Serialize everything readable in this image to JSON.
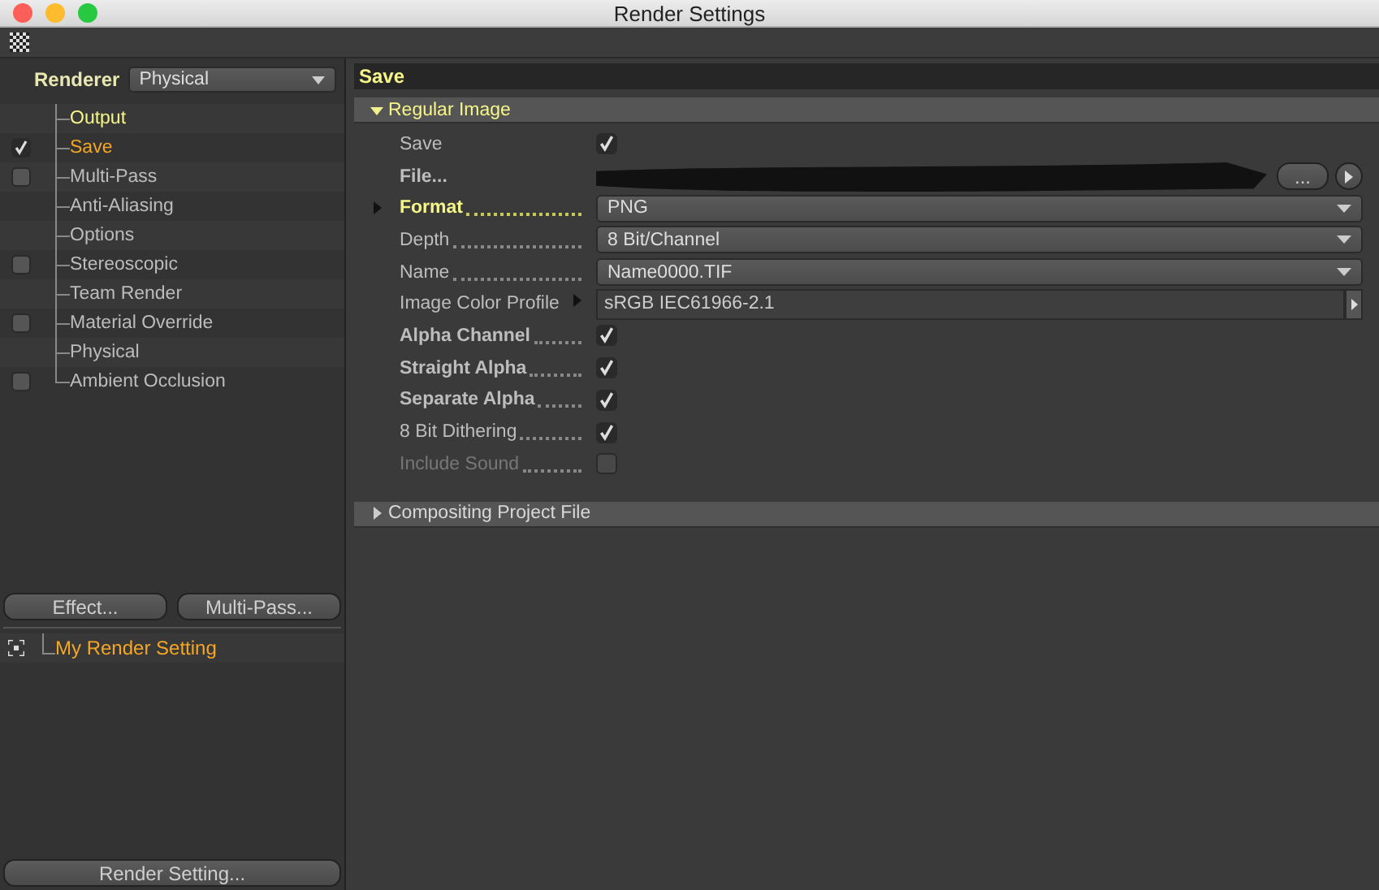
{
  "window": {
    "title": "Render Settings"
  },
  "renderer": {
    "label": "Renderer",
    "value": "Physical"
  },
  "sidebar": {
    "items": [
      {
        "label": "Output",
        "kind": "plain",
        "active": true,
        "selected": false
      },
      {
        "label": "Save",
        "kind": "checkbox",
        "checked": true,
        "active": false,
        "selected": true
      },
      {
        "label": "Multi-Pass",
        "kind": "checkbox",
        "checked": false,
        "active": false,
        "selected": false
      },
      {
        "label": "Anti-Aliasing",
        "kind": "plain",
        "active": false,
        "selected": false
      },
      {
        "label": "Options",
        "kind": "plain",
        "active": false,
        "selected": false
      },
      {
        "label": "Stereoscopic",
        "kind": "checkbox",
        "checked": false,
        "active": false,
        "selected": false
      },
      {
        "label": "Team Render",
        "kind": "plain",
        "active": false,
        "selected": false
      },
      {
        "label": "Material Override",
        "kind": "checkbox",
        "checked": false,
        "active": false,
        "selected": false
      },
      {
        "label": "Physical",
        "kind": "plain",
        "active": false,
        "selected": false
      },
      {
        "label": "Ambient Occlusion",
        "kind": "checkbox",
        "checked": false,
        "active": false,
        "selected": false
      }
    ]
  },
  "sidebar_buttons": [
    "Effect...",
    "Multi-Pass..."
  ],
  "settings_list": [
    {
      "label": "My Render Setting",
      "selected": true
    }
  ],
  "bottom_button": "Render Setting...",
  "panel": {
    "title": "Save",
    "groups": [
      {
        "title": "Regular Image",
        "expanded": true,
        "rows": [
          {
            "kind": "checkbox",
            "label": "Save",
            "checked": true,
            "bold": false,
            "disabled": false,
            "leader": false
          },
          {
            "kind": "file",
            "label": "File...",
            "button": "...",
            "bold": true,
            "disabled": false,
            "leader": false
          },
          {
            "kind": "dropdown",
            "label": "Format",
            "value": "PNG",
            "bold": true,
            "highlight": true,
            "expander": true,
            "disabled": false,
            "leader": true
          },
          {
            "kind": "dropdown",
            "label": "Depth",
            "value": "8 Bit/Channel",
            "bold": false,
            "disabled": false,
            "leader": true
          },
          {
            "kind": "dropdown",
            "label": "Name",
            "value": "Name0000.TIF",
            "bold": false,
            "disabled": false,
            "leader": true
          },
          {
            "kind": "profile",
            "label": "Image Color Profile",
            "value": "sRGB IEC61966-2.1",
            "bold": false,
            "disabled": false,
            "leader": false
          },
          {
            "kind": "checkbox",
            "label": "Alpha Channel",
            "checked": true,
            "bold": true,
            "disabled": false,
            "leader": true
          },
          {
            "kind": "checkbox",
            "label": "Straight Alpha",
            "checked": true,
            "bold": true,
            "disabled": false,
            "leader": true
          },
          {
            "kind": "checkbox",
            "label": "Separate Alpha",
            "checked": true,
            "bold": true,
            "disabled": false,
            "leader": true
          },
          {
            "kind": "checkbox",
            "label": "8 Bit Dithering",
            "checked": true,
            "bold": false,
            "disabled": false,
            "leader": true
          },
          {
            "kind": "checkbox",
            "label": "Include Sound",
            "checked": false,
            "bold": false,
            "disabled": true,
            "leader": true
          }
        ]
      },
      {
        "title": "Compositing Project File",
        "expanded": false
      }
    ]
  }
}
